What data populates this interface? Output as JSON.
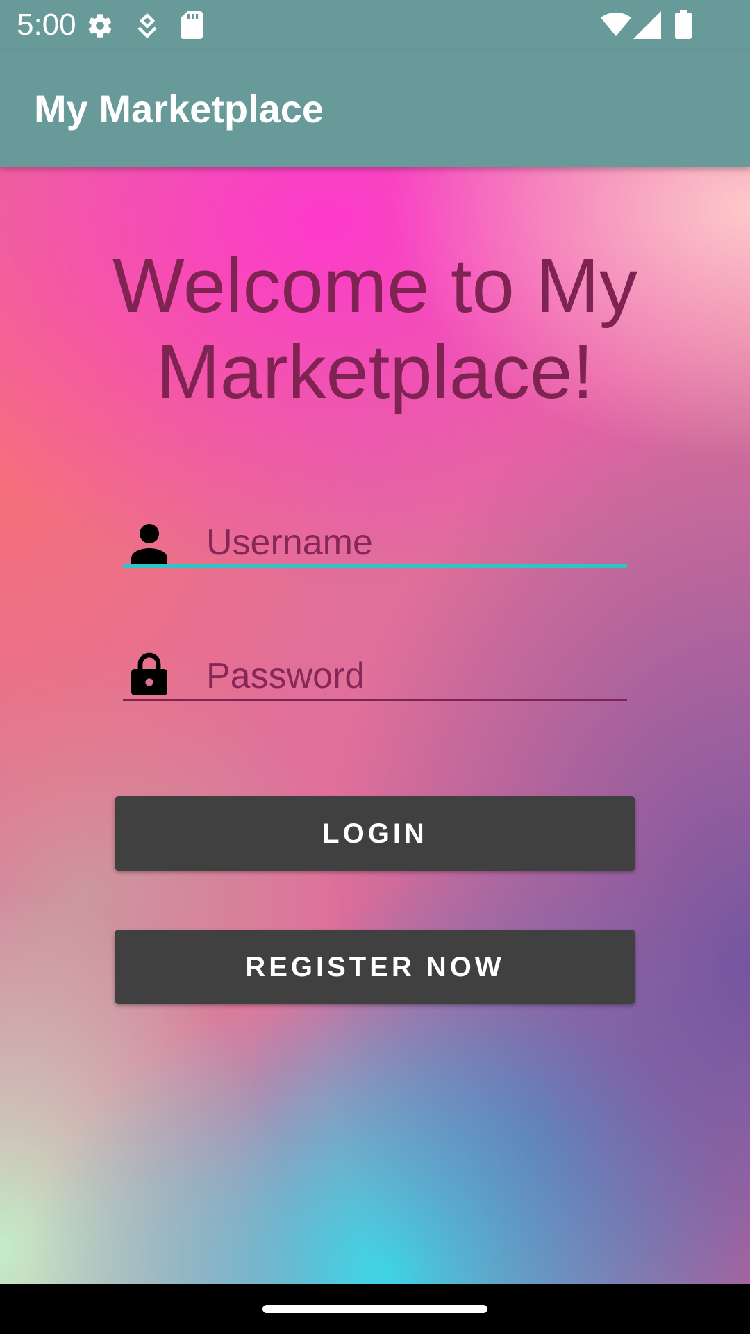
{
  "status_bar": {
    "time": "5:00",
    "left_icons": [
      "gear-icon",
      "assistant-icon",
      "sd-card-icon"
    ],
    "right_icons": [
      "wifi-icon",
      "cell-signal-icon",
      "battery-icon"
    ]
  },
  "app_bar": {
    "title": "My Marketplace"
  },
  "main": {
    "welcome": "Welcome to My Marketplace!",
    "username": {
      "placeholder": "Username",
      "value": "",
      "icon": "person-icon"
    },
    "password": {
      "placeholder": "Password",
      "value": "",
      "icon": "lock-icon"
    },
    "login_label": "LOGIN",
    "register_label": "REGISTER NOW"
  },
  "colors": {
    "app_bar": "#689a99",
    "accent": "#2ec5c5",
    "text": "#7e2352",
    "button": "#404040"
  }
}
